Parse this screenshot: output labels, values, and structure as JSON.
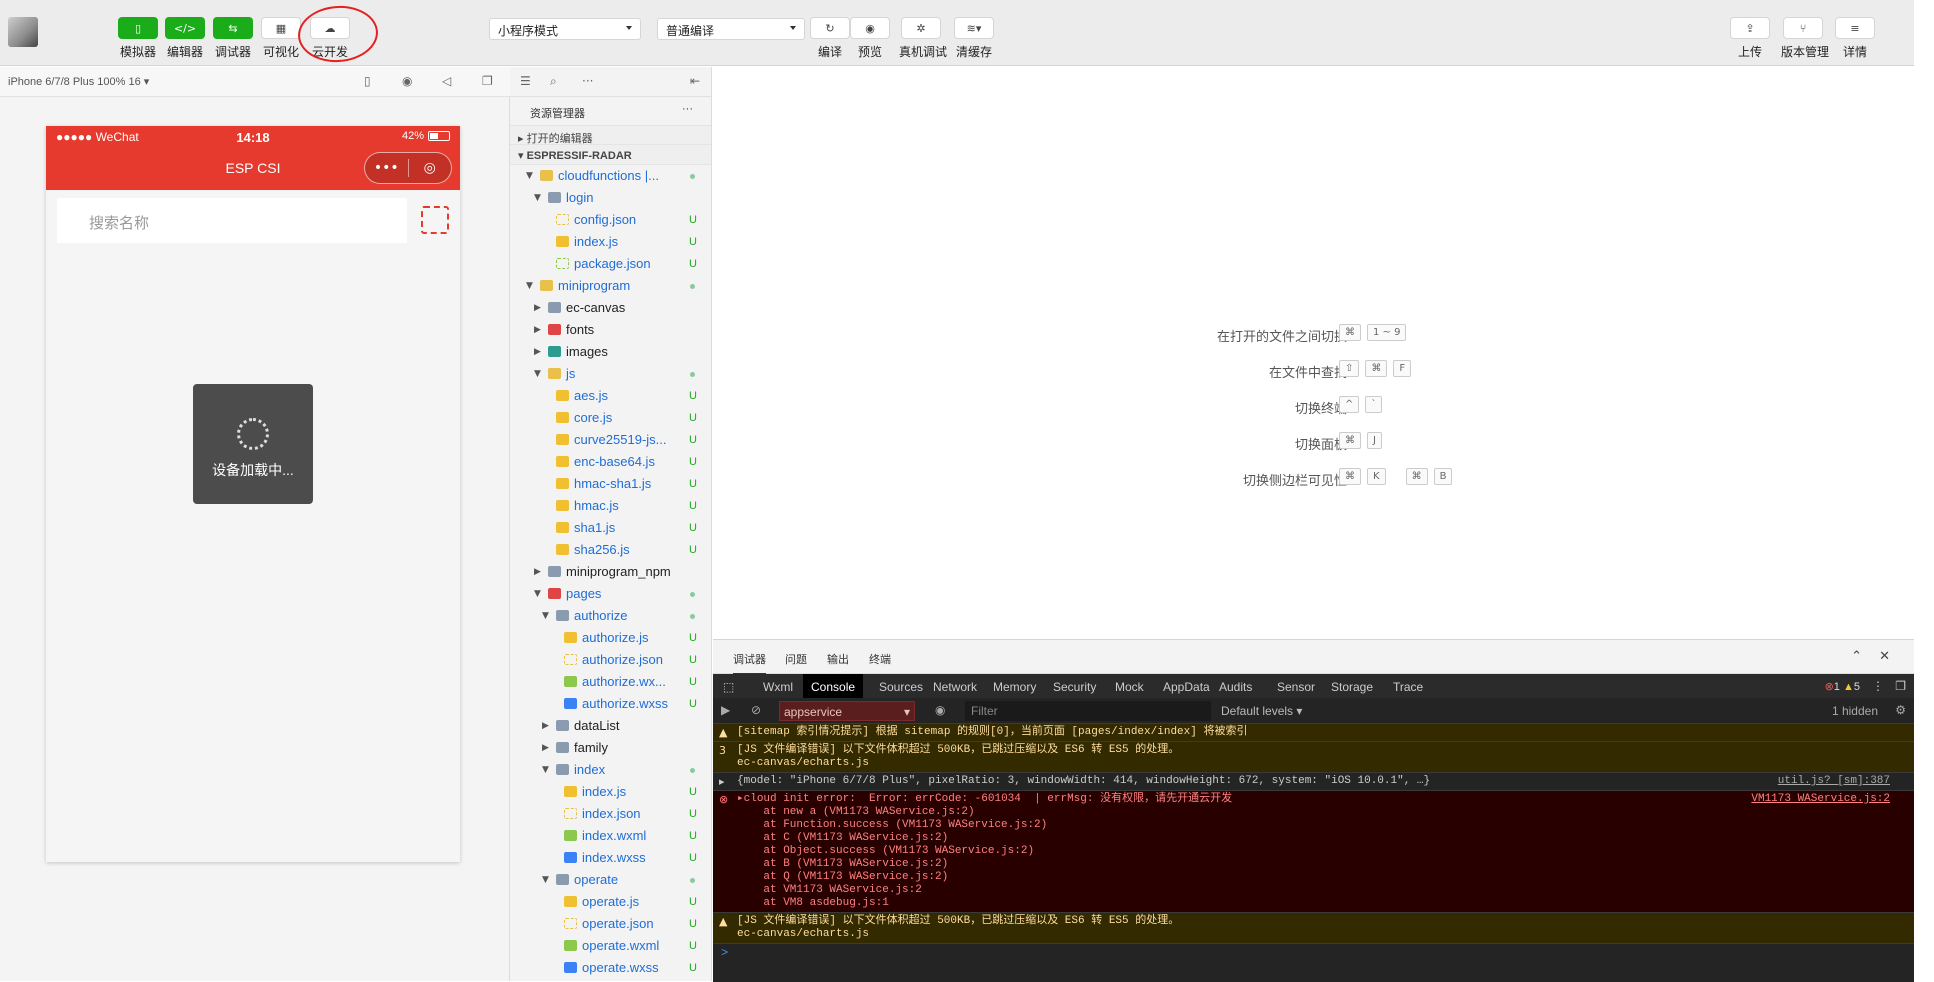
{
  "toolbar": {
    "buttons": [
      {
        "label": "模拟器",
        "icon": "phone-icon"
      },
      {
        "label": "编辑器",
        "icon": "code-icon"
      },
      {
        "label": "调试器",
        "icon": "debug-icon"
      },
      {
        "label": "可视化",
        "icon": "layout-icon"
      },
      {
        "label": "云开发",
        "icon": "cloud-icon"
      }
    ],
    "mode_select": "小程序模式",
    "compile_select": "普通编译",
    "actions": [
      {
        "label": "编译",
        "icon": "refresh-icon"
      },
      {
        "label": "预览",
        "icon": "eye-icon"
      },
      {
        "label": "真机调试",
        "icon": "bug-icon"
      },
      {
        "label": "清缓存",
        "icon": "layers-icon"
      }
    ],
    "right_actions": [
      {
        "label": "上传",
        "icon": "upload-icon"
      },
      {
        "label": "版本管理",
        "icon": "branch-icon"
      },
      {
        "label": "详情",
        "icon": "menu-icon"
      }
    ]
  },
  "simulator": {
    "device": "iPhone 6/7/8 Plus 100% 16 ▾",
    "status_left": "●●●●● WeChat",
    "time": "14:18",
    "battery": "42%",
    "nav_title": "ESP CSI",
    "search_placeholder": "搜索名称",
    "loading_text": "设备加载中..."
  },
  "explorer": {
    "title": "资源管理器",
    "open_editors": "打开的编辑器",
    "project": "ESPRESSIF-RADAR",
    "tree": [
      {
        "name": "cloudfunctions |...",
        "depth": 1,
        "type": "folder-open",
        "color": "#e8c04a",
        "status": "dot",
        "open": true
      },
      {
        "name": "login",
        "depth": 2,
        "type": "folder-open",
        "color": "#8a9bb0",
        "status": "",
        "open": true
      },
      {
        "name": "config.json",
        "depth": 3,
        "type": "json",
        "color": "#e8c04a",
        "status": "U"
      },
      {
        "name": "index.js",
        "depth": 3,
        "type": "js",
        "color": "#f0c030",
        "status": "U"
      },
      {
        "name": "package.json",
        "depth": 3,
        "type": "json",
        "color": "#8cc84b",
        "status": "U"
      },
      {
        "name": "miniprogram",
        "depth": 1,
        "type": "folder-open",
        "color": "#e8c04a",
        "status": "dot",
        "open": true
      },
      {
        "name": "ec-canvas",
        "depth": 2,
        "type": "folder",
        "color": "#8a9bb0",
        "status": "",
        "open": false,
        "dark": true
      },
      {
        "name": "fonts",
        "depth": 2,
        "type": "folder",
        "color": "#e04545",
        "status": "",
        "open": false,
        "dark": true
      },
      {
        "name": "images",
        "depth": 2,
        "type": "folder",
        "color": "#2a9d8f",
        "status": "",
        "open": false,
        "dark": true
      },
      {
        "name": "js",
        "depth": 2,
        "type": "folder-open",
        "color": "#e8c04a",
        "status": "dot",
        "open": true
      },
      {
        "name": "aes.js",
        "depth": 3,
        "type": "js",
        "color": "#f0c030",
        "status": "U"
      },
      {
        "name": "core.js",
        "depth": 3,
        "type": "js",
        "color": "#f0c030",
        "status": "U"
      },
      {
        "name": "curve25519-js...",
        "depth": 3,
        "type": "js",
        "color": "#f0c030",
        "status": "U"
      },
      {
        "name": "enc-base64.js",
        "depth": 3,
        "type": "js",
        "color": "#f0c030",
        "status": "U"
      },
      {
        "name": "hmac-sha1.js",
        "depth": 3,
        "type": "js",
        "color": "#f0c030",
        "status": "U"
      },
      {
        "name": "hmac.js",
        "depth": 3,
        "type": "js",
        "color": "#f0c030",
        "status": "U"
      },
      {
        "name": "sha1.js",
        "depth": 3,
        "type": "js",
        "color": "#f0c030",
        "status": "U"
      },
      {
        "name": "sha256.js",
        "depth": 3,
        "type": "js",
        "color": "#f0c030",
        "status": "U"
      },
      {
        "name": "miniprogram_npm",
        "depth": 2,
        "type": "folder",
        "color": "#8a9bb0",
        "status": "",
        "open": false,
        "dark": true
      },
      {
        "name": "pages",
        "depth": 2,
        "type": "folder-open",
        "color": "#e04545",
        "status": "dot",
        "open": true
      },
      {
        "name": "authorize",
        "depth": 3,
        "type": "folder-open",
        "color": "#8a9bb0",
        "status": "dot",
        "open": true
      },
      {
        "name": "authorize.js",
        "depth": 4,
        "type": "js",
        "color": "#f0c030",
        "status": "U"
      },
      {
        "name": "authorize.json",
        "depth": 4,
        "type": "json",
        "color": "#e8c04a",
        "status": "U"
      },
      {
        "name": "authorize.wx...",
        "depth": 4,
        "type": "wxml",
        "color": "#8cc84b",
        "status": "U"
      },
      {
        "name": "authorize.wxss",
        "depth": 4,
        "type": "wxss",
        "color": "#3b82f6",
        "status": "U"
      },
      {
        "name": "dataList",
        "depth": 3,
        "type": "folder",
        "color": "#8a9bb0",
        "status": "",
        "open": false,
        "dark": true
      },
      {
        "name": "family",
        "depth": 3,
        "type": "folder",
        "color": "#8a9bb0",
        "status": "",
        "open": false,
        "dark": true
      },
      {
        "name": "index",
        "depth": 3,
        "type": "folder-open",
        "color": "#8a9bb0",
        "status": "dot",
        "open": true
      },
      {
        "name": "index.js",
        "depth": 4,
        "type": "js",
        "color": "#f0c030",
        "status": "U"
      },
      {
        "name": "index.json",
        "depth": 4,
        "type": "json",
        "color": "#e8c04a",
        "status": "U"
      },
      {
        "name": "index.wxml",
        "depth": 4,
        "type": "wxml",
        "color": "#8cc84b",
        "status": "U"
      },
      {
        "name": "index.wxss",
        "depth": 4,
        "type": "wxss",
        "color": "#3b82f6",
        "status": "U"
      },
      {
        "name": "operate",
        "depth": 3,
        "type": "folder-open",
        "color": "#8a9bb0",
        "status": "dot",
        "open": true
      },
      {
        "name": "operate.js",
        "depth": 4,
        "type": "js",
        "color": "#f0c030",
        "status": "U"
      },
      {
        "name": "operate.json",
        "depth": 4,
        "type": "json",
        "color": "#e8c04a",
        "status": "U"
      },
      {
        "name": "operate.wxml",
        "depth": 4,
        "type": "wxml",
        "color": "#8cc84b",
        "status": "U"
      },
      {
        "name": "operate.wxss",
        "depth": 4,
        "type": "wxss",
        "color": "#3b82f6",
        "status": "U"
      }
    ]
  },
  "editor": {
    "shortcuts": [
      {
        "label": "在打开的文件之间切换",
        "keys": [
          [
            "⌘",
            "1 ~ 9"
          ]
        ]
      },
      {
        "label": "在文件中查找",
        "keys": [
          [
            "⇧",
            "⌘",
            "F"
          ]
        ]
      },
      {
        "label": "切换终端",
        "keys": [
          [
            "^",
            "`"
          ]
        ]
      },
      {
        "label": "切换面板",
        "keys": [
          [
            "⌘",
            "J"
          ]
        ]
      },
      {
        "label": "切换侧边栏可见性",
        "keys": [
          [
            "⌘",
            "K"
          ],
          [
            "⌘",
            "B"
          ]
        ]
      }
    ]
  },
  "panel": {
    "tabs": [
      "调试器",
      "问题",
      "输出",
      "终端"
    ],
    "devtools_tabs": [
      "Wxml",
      "Console",
      "Sources",
      "Network",
      "Memory",
      "Security",
      "Mock",
      "AppData",
      "Audits",
      "Sensor",
      "Storage",
      "Trace"
    ],
    "active_devtool": "Console",
    "error_count": "1",
    "warning_count": "5",
    "context": "appservice",
    "filter_placeholder": "Filter",
    "levels": "Default levels ▾",
    "hidden": "1 hidden",
    "console_lines": [
      {
        "kind": "warn",
        "icon": "▲",
        "text": "[sitemap 索引情况提示] 根据 sitemap 的规则[0]，当前页面 [pages/index/index] 将被索引",
        "src": ""
      },
      {
        "kind": "warn",
        "icon": "3",
        "text": "[JS 文件编译错误] 以下文件体积超过 500KB，已跳过压缩以及 ES6 转 ES5 的处理。\nec-canvas/echarts.js",
        "src": ""
      },
      {
        "kind": "log",
        "icon": "▸",
        "text": "{model: \"iPhone 6/7/8 Plus\", pixelRatio: 3, windowWidth: 414, windowHeight: 672, system: \"iOS 10.0.1\", …}",
        "src": "util.js? [sm]:387"
      },
      {
        "kind": "err",
        "icon": "⊗",
        "text": "▸cloud init error:  Error: errCode: -601034  | errMsg: 没有权限，请先开通云开发\n    at new a (VM1173 WAService.js:2)\n    at Function.success (VM1173 WAService.js:2)\n    at C (VM1173 WAService.js:2)\n    at Object.success (VM1173 WAService.js:2)\n    at B (VM1173 WAService.js:2)\n    at Q (VM1173 WAService.js:2)\n    at VM1173 WAService.js:2\n    at VM8 asdebug.js:1",
        "src": "VM1173 WAService.js:2"
      },
      {
        "kind": "warn",
        "icon": "▲",
        "text": "[JS 文件编译错误] 以下文件体积超过 500KB，已跳过压缩以及 ES6 转 ES5 的处理。\nec-canvas/echarts.js",
        "src": ""
      }
    ],
    "prompt": ">"
  },
  "colors": {
    "accent_green": "#1aad19",
    "nav_red": "#e53a2d",
    "annotation_red": "#e52020"
  }
}
